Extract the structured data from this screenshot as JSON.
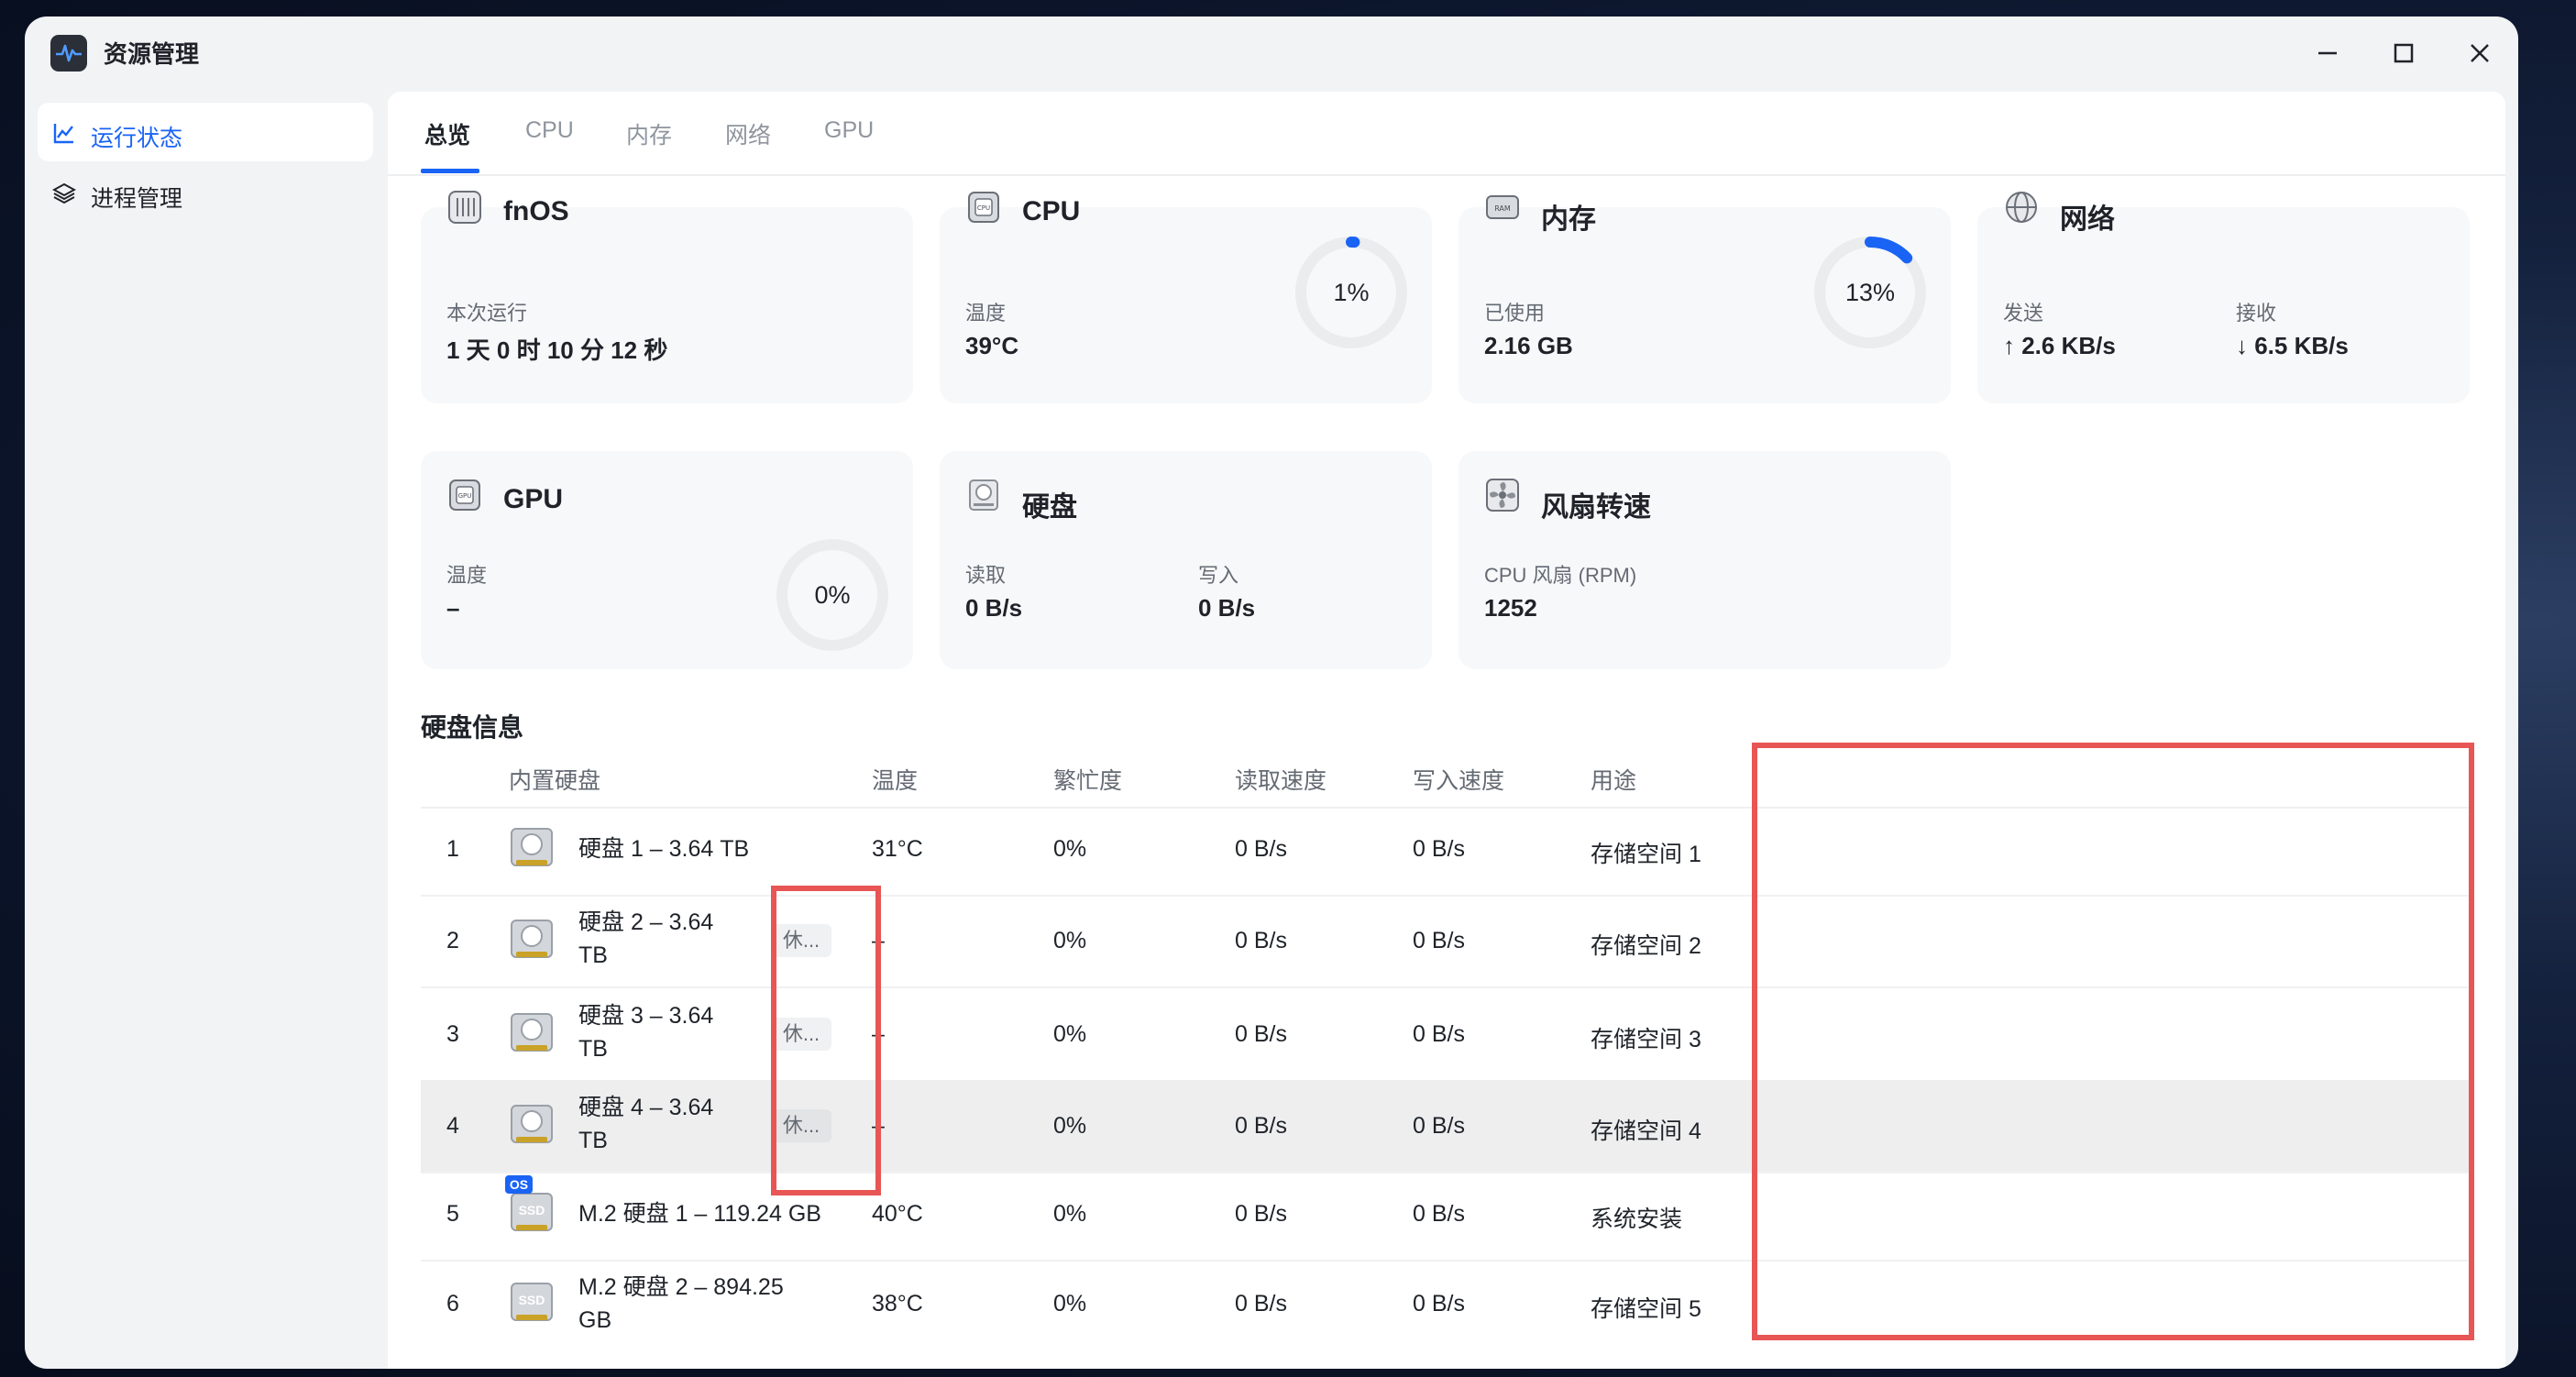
{
  "window": {
    "title": "资源管理",
    "controls": [
      "minimize-icon",
      "maximize-icon",
      "close-icon"
    ]
  },
  "sidebar": {
    "items": [
      {
        "label": "运行状态",
        "icon": "chart-line-icon",
        "active": true
      },
      {
        "label": "进程管理",
        "icon": "layers-icon",
        "active": false
      }
    ]
  },
  "tabs": [
    {
      "label": "总览",
      "active": true
    },
    {
      "label": "CPU"
    },
    {
      "label": "内存"
    },
    {
      "label": "网络"
    },
    {
      "label": "GPU"
    }
  ],
  "accent_color": "#1a64f5",
  "cards": {
    "fnos": {
      "title": "fnOS",
      "label": "本次运行",
      "value": "1 天 0 时 10 分 12 秒"
    },
    "cpu": {
      "title": "CPU",
      "label": "温度",
      "value": "39°C",
      "usage_text": "1%",
      "usage": 0.01
    },
    "memory": {
      "title": "内存",
      "label": "已使用",
      "value": "2.16 GB",
      "usage_text": "13%",
      "usage": 0.13
    },
    "network": {
      "title": "网络",
      "send_label": "发送",
      "send_value": "↑ 2.6 KB/s",
      "recv_label": "接收",
      "recv_value": "↓ 6.5 KB/s"
    },
    "gpu": {
      "title": "GPU",
      "label": "温度",
      "value": "–",
      "usage_text": "0%",
      "usage": 0
    },
    "disk": {
      "title": "硬盘",
      "read_label": "读取",
      "read_value": "0 B/s",
      "write_label": "写入",
      "write_value": "0 B/s"
    },
    "fan": {
      "title": "风扇转速",
      "label": "CPU 风扇 (RPM)",
      "value": "1252"
    }
  },
  "disk_info": {
    "title": "硬盘信息",
    "columns": [
      "内置硬盘",
      "温度",
      "繁忙度",
      "读取速度",
      "写入速度",
      "用途"
    ],
    "rows": [
      {
        "index": "1",
        "name_l1": "硬盘 1 – 3.64 TB",
        "name_l2": "",
        "badge": "",
        "os": "",
        "type": "hdd",
        "temp": "31°C",
        "busy": "0%",
        "read": "0 B/s",
        "write": "0 B/s",
        "use": "存储空间 1"
      },
      {
        "index": "2",
        "name_l1": "硬盘 2 – 3.64",
        "name_l2": "TB",
        "badge": "休...",
        "os": "",
        "type": "hdd",
        "temp": "–",
        "busy": "0%",
        "read": "0 B/s",
        "write": "0 B/s",
        "use": "存储空间 2"
      },
      {
        "index": "3",
        "name_l1": "硬盘 3 – 3.64",
        "name_l2": "TB",
        "badge": "休...",
        "os": "",
        "type": "hdd",
        "temp": "–",
        "busy": "0%",
        "read": "0 B/s",
        "write": "0 B/s",
        "use": "存储空间 3"
      },
      {
        "index": "4",
        "name_l1": "硬盘 4 – 3.64",
        "name_l2": "TB",
        "badge": "休...",
        "os": "",
        "type": "hdd",
        "temp": "–",
        "busy": "0%",
        "read": "0 B/s",
        "write": "0 B/s",
        "use": "存储空间 4",
        "highlighted": true
      },
      {
        "index": "5",
        "name_l1": "M.2 硬盘 1 – 119.24 GB",
        "name_l2": "",
        "badge": "",
        "os": "OS",
        "type": "ssd",
        "ssd_label": "SSD",
        "temp": "40°C",
        "busy": "0%",
        "read": "0 B/s",
        "write": "0 B/s",
        "use": "系统安装"
      },
      {
        "index": "6",
        "name_l1": "M.2 硬盘 2 – 894.25",
        "name_l2": "GB",
        "badge": "",
        "os": "",
        "type": "ssd",
        "ssd_label": "SSD",
        "temp": "38°C",
        "busy": "0%",
        "read": "0 B/s",
        "write": "0 B/s",
        "use": "存储空间 5"
      }
    ]
  }
}
